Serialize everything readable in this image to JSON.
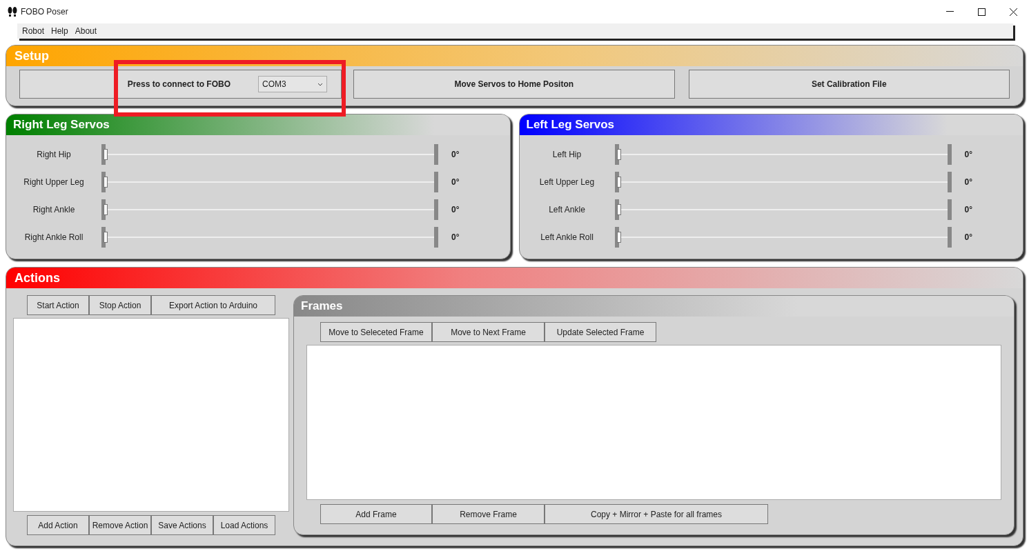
{
  "window": {
    "title": "FOBO Poser"
  },
  "menu": [
    "Robot",
    "Help",
    "About"
  ],
  "setup": {
    "title": "Setup",
    "connect_button": "Press to connect to FOBO",
    "port": "COM3",
    "buttons": [
      "Move Servos to Home Positon",
      "Set Calibration File"
    ]
  },
  "servo_panels": [
    {
      "title": "Right Leg Servos",
      "color": "#008000",
      "servos": [
        {
          "name": "Right Hip",
          "level": 0,
          "reading": "0°"
        },
        {
          "name": "Right Upper Leg",
          "level": 0,
          "reading": "0°"
        },
        {
          "name": "Right Ankle",
          "level": 0,
          "reading": "0°"
        },
        {
          "name": "Right Ankle Roll",
          "level": 0,
          "reading": "0°"
        }
      ]
    },
    {
      "title": "Left Leg Servos",
      "color": "#0000ff",
      "servos": [
        {
          "name": "Left Hip",
          "level": 0,
          "reading": "0°"
        },
        {
          "name": "Left Upper Leg",
          "level": 0,
          "reading": "0°"
        },
        {
          "name": "Left Ankle",
          "level": 0,
          "reading": "0°"
        },
        {
          "name": "Left Ankle Roll",
          "level": 0,
          "reading": "0°"
        }
      ]
    }
  ],
  "actions": {
    "title": "Actions",
    "top_buttons": [
      "Start Action",
      "Stop Action",
      "Export Action to Arduino"
    ],
    "bottom_buttons": [
      "Add Action",
      "Remove Action",
      "Save Actions",
      "Load Actions"
    ]
  },
  "frames": {
    "title": "Frames",
    "top_buttons": [
      "Move to Seleceted Frame",
      "Move to Next Frame",
      "Update Selected Frame"
    ],
    "bottom_buttons": [
      "Add Frame",
      "Remove Frame",
      "Copy + Mirror + Paste for all frames"
    ]
  }
}
